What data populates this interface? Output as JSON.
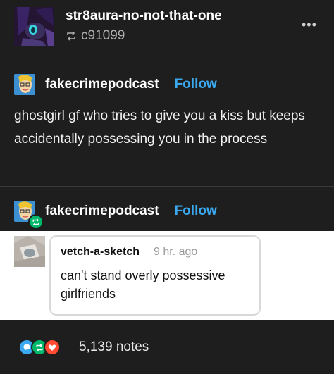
{
  "header": {
    "blog_name": "str8aura-no-not-that-one",
    "reblogged_from": "c91099",
    "more_label": "•••"
  },
  "original_post": {
    "blog_name": "fakecrimepodcast",
    "follow_label": "Follow",
    "text": "ghostgirl gf who tries to give you a kiss but keeps accidentally possessing you in the process"
  },
  "reblog": {
    "blog_name": "fakecrimepodcast",
    "follow_label": "Follow"
  },
  "reply": {
    "username": "vetch-a-sketch",
    "time": "9 hr. ago",
    "text": "can't stand overly possessive girlfriends"
  },
  "footer": {
    "notes_count": "5,139 notes"
  },
  "colors": {
    "background": "#1e1e1e",
    "follow": "#3aa9f0",
    "reblog_green": "#00b869",
    "reply_blue": "#3aa9f0",
    "like_red": "#ff4930"
  },
  "icons": {
    "reblog": "reblog-icon",
    "more": "more-icon",
    "reply": "reply-icon",
    "like": "heart-icon"
  }
}
